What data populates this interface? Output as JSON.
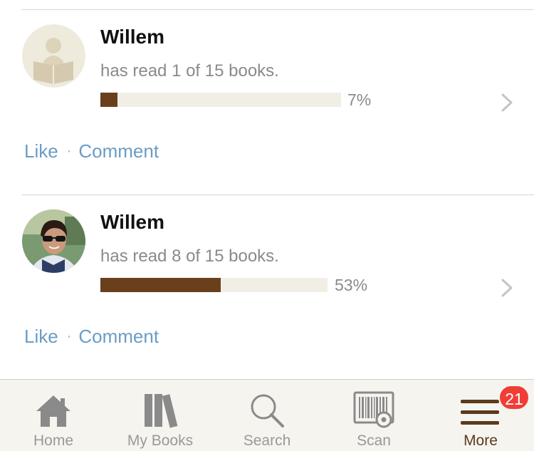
{
  "feed": {
    "items": [
      {
        "name": "Willem",
        "status": "has read 1 of 15 books.",
        "progress_fraction": 0.07,
        "progress_label": "7%",
        "avatar": "placeholder-reader-avatar",
        "like_label": "Like",
        "separator": "·",
        "comment_label": "Comment"
      },
      {
        "name": "Willem",
        "status": "has read 8 of 15 books.",
        "progress_fraction": 0.53,
        "progress_label": "53%",
        "avatar": "photo-avatar",
        "like_label": "Like",
        "separator": "·",
        "comment_label": "Comment"
      }
    ]
  },
  "tabbar": {
    "tabs": [
      {
        "label": "Home",
        "icon": "home-icon"
      },
      {
        "label": "My Books",
        "icon": "books-icon"
      },
      {
        "label": "Search",
        "icon": "search-icon"
      },
      {
        "label": "Scan",
        "icon": "barcode-scan-icon"
      },
      {
        "label": "More",
        "icon": "hamburger-menu-icon",
        "badge": "21",
        "active": true
      }
    ]
  },
  "colors": {
    "progress_fill": "#6a3f1c",
    "progress_track": "#f1eee6",
    "link": "#6b9cc6",
    "badge": "#f03d36",
    "active_tab": "#5b3a1d"
  }
}
